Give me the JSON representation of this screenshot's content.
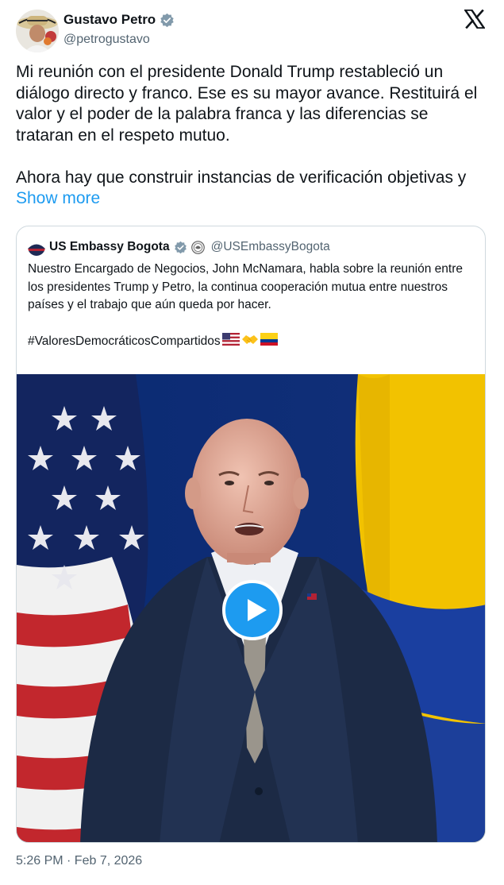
{
  "author": {
    "name": "Gustavo Petro",
    "handle": "@petrogustavo"
  },
  "post": {
    "text": "Mi reunión con el presidente Donald Trump restableció un diálogo directo y franco. Ese es su mayor avance. Restituirá el valor y el poder de la palabra franca y las diferencias se trataran en el respeto mutuo.\n\nAhora hay que construir instancias de verificación objetivas y ",
    "show_more": "Show more",
    "timestamp": "5:26 PM · Feb 7, 2026"
  },
  "quote": {
    "name": "US Embassy Bogota",
    "handle": "@USEmbassyBogota",
    "text": "Nuestro Encargado de Negocios, John McNamara, habla sobre la reunión entre los presidentes Trump y Petro, la continua cooperación mutua entre nuestros países y el trabajo que aún queda por hacer.",
    "hashtag": "#ValoresDemocráticosCompartidos",
    "emojis": [
      "flag-us",
      "handshake",
      "flag-colombia"
    ]
  },
  "icons": [
    "verified-badge",
    "x-logo",
    "government-seal",
    "play-icon"
  ],
  "colors": {
    "accent": "#1d9bf0",
    "secondary_text": "#536471",
    "primary_text": "#0f1419",
    "border": "#cfd9de"
  }
}
